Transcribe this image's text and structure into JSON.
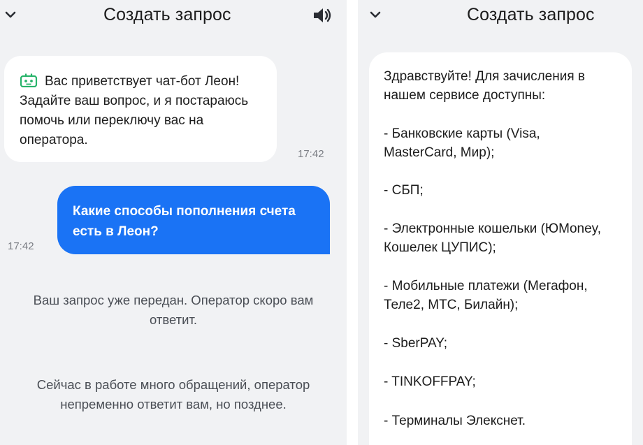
{
  "left_panel": {
    "header": {
      "title": "Создать запрос"
    },
    "messages": [
      {
        "from": "bot",
        "lines": [
          "Вас приветствует чат-бот Леон!",
          "Задайте ваш вопрос, и я постараюсь",
          "помочь или переключу вас на",
          "оператора."
        ],
        "time": "17:42"
      },
      {
        "from": "user",
        "lines": [
          "Какие способы пополнения счета",
          "есть в Леон?"
        ],
        "time": "17:42"
      }
    ],
    "system_messages": [
      {
        "lines": [
          "Ваш запрос уже передан. Оператор скоро вам",
          "ответит."
        ]
      },
      {
        "lines": [
          "Сейчас в работе много обращений, оператор",
          "непременно ответит вам, но позднее."
        ]
      }
    ]
  },
  "right_panel": {
    "header": {
      "title": "Создать запрос"
    },
    "card_lines": [
      "Здравствуйте! Для зачисления в",
      "нашем сервисе доступны:",
      "- Банковские карты (Visa,",
      "MasterCard, Мир);",
      "- СБП;",
      "- Электронные кошельки (ЮMoney,",
      "Кошелек ЦУПИС);",
      "- Мобильные платежи (Мегафон,",
      "Теле2, МТС, Билайн);",
      "- SberPAY;",
      "- TINKOFFPAY;",
      "- Терминалы Элекснет."
    ]
  },
  "icons": [
    "chevron-down-icon",
    "speaker-icon",
    "bot-icon"
  ],
  "colors": {
    "user_bubble": "#1a73f5",
    "bot_icon": "#27b36a",
    "background": "#f1f2f4"
  }
}
